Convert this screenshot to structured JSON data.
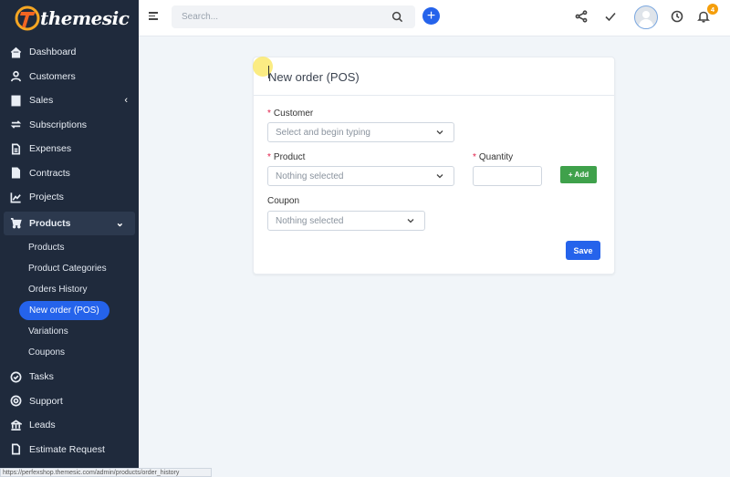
{
  "app": {
    "logo_text": "themesic"
  },
  "search": {
    "placeholder": "Search..."
  },
  "notifications": {
    "count": "4"
  },
  "sidebar": {
    "items": [
      {
        "label": "Dashboard",
        "icon": "home-icon"
      },
      {
        "label": "Customers",
        "icon": "user-icon"
      },
      {
        "label": "Sales",
        "icon": "receipt-icon",
        "chevron": "‹"
      },
      {
        "label": "Subscriptions",
        "icon": "refresh-icon"
      },
      {
        "label": "Expenses",
        "icon": "file-icon"
      },
      {
        "label": "Contracts",
        "icon": "document-icon"
      },
      {
        "label": "Projects",
        "icon": "chart-icon"
      },
      {
        "label": "Products",
        "icon": "cart-icon",
        "chevron": "⌄"
      }
    ],
    "sub_items": [
      {
        "label": "Products"
      },
      {
        "label": "Product Categories"
      },
      {
        "label": "Orders History"
      },
      {
        "label": "New order (POS)"
      },
      {
        "label": "Variations"
      },
      {
        "label": "Coupons"
      }
    ],
    "items_after": [
      {
        "label": "Tasks",
        "icon": "check-circle-icon"
      },
      {
        "label": "Support",
        "icon": "lifebuoy-icon"
      },
      {
        "label": "Leads",
        "icon": "leads-icon"
      },
      {
        "label": "Estimate Request",
        "icon": "document-icon"
      }
    ]
  },
  "status_bar": {
    "url": "https://perfexshop.themesic.com/admin/products/order_history"
  },
  "form": {
    "title": "New order (POS)",
    "customer_label": "Customer",
    "customer_placeholder": "Select and begin typing",
    "product_label": "Product",
    "product_placeholder": "Nothing selected",
    "quantity_label": "Quantity",
    "quantity_value": "",
    "add_label": "Add",
    "coupon_label": "Coupon",
    "coupon_placeholder": "Nothing selected",
    "save_label": "Save",
    "required_mark": "*"
  },
  "colors": {
    "sidebar_bg": "#1f2a3c",
    "accent": "#2563eb",
    "success": "#3fa14b",
    "badge": "#f59e0b",
    "required": "#e11d48"
  }
}
